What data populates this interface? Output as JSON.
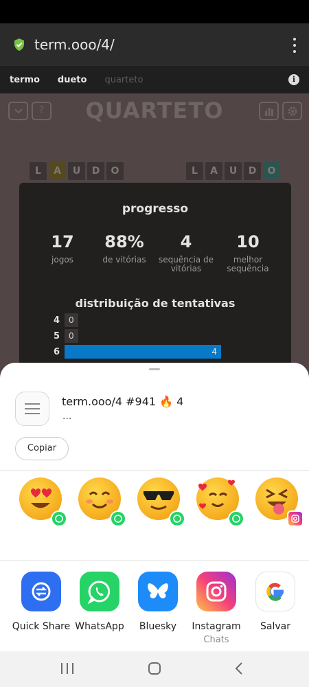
{
  "browser": {
    "url": "term.ooo/4/"
  },
  "nav": {
    "tabs": [
      "termo",
      "dueto",
      "quarteto"
    ]
  },
  "game": {
    "title": "QUARTETO",
    "help_label": "?",
    "word_left": [
      "L",
      "A",
      "U",
      "D",
      "O"
    ],
    "word_right": [
      "L",
      "A",
      "U",
      "D",
      "O"
    ]
  },
  "stats": {
    "heading": "progresso",
    "items": [
      {
        "value": "17",
        "label": "jogos"
      },
      {
        "value": "88%",
        "label": "de vitórias"
      },
      {
        "value": "4",
        "label": "sequência de vitórias"
      },
      {
        "value": "10",
        "label": "melhor sequência"
      }
    ],
    "distribution_heading": "distribuição de tentativas",
    "distribution": [
      {
        "attempt": "4",
        "count": "0"
      },
      {
        "attempt": "5",
        "count": "0"
      },
      {
        "attempt": "6",
        "count": "4"
      }
    ]
  },
  "share": {
    "title": "term.ooo/4 #941 🔥 4",
    "subtitle": "...",
    "copy_label": "Copiar",
    "contacts": [
      {
        "expression": "heart-eyes",
        "badge": "whatsapp"
      },
      {
        "expression": "smiling",
        "badge": "whatsapp"
      },
      {
        "expression": "sunglasses",
        "badge": "whatsapp"
      },
      {
        "expression": "smiling-hearts",
        "badge": "whatsapp"
      },
      {
        "expression": "squinting-tongue",
        "badge": "instagram"
      }
    ],
    "apps": [
      {
        "label": "Quick Share",
        "sub": "",
        "icon": "quick-share-icon",
        "color": "#2e6ef0"
      },
      {
        "label": "WhatsApp",
        "sub": "",
        "icon": "whatsapp-icon",
        "color": "#25d366"
      },
      {
        "label": "Bluesky",
        "sub": "",
        "icon": "bluesky-icon",
        "color": "#1d8cf8"
      },
      {
        "label": "Instagram",
        "sub": "Chats",
        "icon": "instagram-icon",
        "color": "#e1306c"
      },
      {
        "label": "Salvar",
        "sub": "",
        "icon": "google-icon",
        "color": "#ffffff"
      }
    ]
  }
}
